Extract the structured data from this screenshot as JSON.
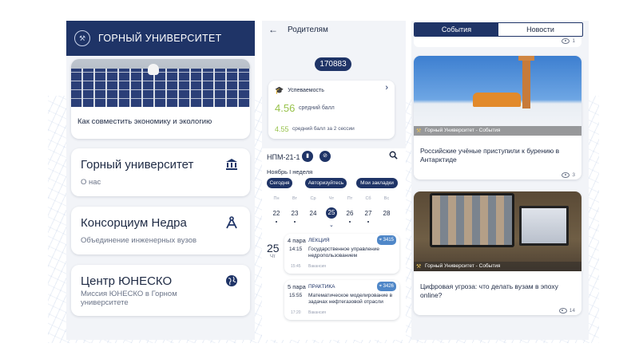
{
  "app1": {
    "header_title": "ГОРНЫЙ УНИВЕРСИТЕТ",
    "featured_caption": "Как совместить экономику и экологию",
    "menu": [
      {
        "title": "Горный университет",
        "subtitle": "О нас"
      },
      {
        "title": "Консорциум Недра",
        "subtitle": "Объединение инженерных вузов"
      },
      {
        "title": "Центр ЮНЕСКО",
        "subtitle": "Миссия ЮНЕСКО в Горном университете"
      }
    ]
  },
  "app2": {
    "header_title": "Родителям",
    "student_id": "170883",
    "performance": {
      "label": "Успеваемость",
      "avg": "4.56",
      "avg_label": "средний балл",
      "avg2": "4.55",
      "avg2_label": "средний балл за 2 сессии"
    },
    "schedule": {
      "group": "НПМ-21-1",
      "week": "Ноябрь I неделя",
      "chips": [
        "Сегодня",
        "Авторизуйтесь",
        "Мои закладки"
      ],
      "day_names": [
        "Пн",
        "Вт",
        "Ср",
        "Чт",
        "Пт",
        "Сб",
        "Вс"
      ],
      "day_numbers": [
        "22",
        "23",
        "24",
        "25",
        "26",
        "27",
        "28"
      ],
      "selected_day": "25",
      "selected_dow": "Чт",
      "lessons": [
        {
          "number": "4 пара",
          "type": "ЛЕКЦИЯ",
          "room": "3415",
          "start": "14:15",
          "end": "15:45",
          "name": "Государственное управление недропользованием",
          "note": "Вакансия"
        },
        {
          "number": "5 пара",
          "type": "ПРАКТИКА",
          "room": "3426",
          "start": "15:55",
          "end": "17:20",
          "name": "Математическое моделирование в задачах нефтегазовой отрасли",
          "note": "Вакансия"
        }
      ]
    }
  },
  "app3": {
    "tabs": [
      "События",
      "Новости"
    ],
    "active_tab": "События",
    "top_views": "1",
    "news": [
      {
        "caption": "Горный Университет - События",
        "title": "Российские учёные приступили к бурению в Антарктиде",
        "views": "3"
      },
      {
        "caption": "Горный Университет - События",
        "title": "Цифровая угроза: что делать вузам в эпоху online?",
        "views": "14"
      }
    ]
  },
  "colors": {
    "primary": "#1f3467",
    "accent_green": "#97c24a",
    "room_badge": "#4f87c8"
  },
  "icons": {
    "logo": "university-emblem-icon",
    "menu1": "institution-icon",
    "menu2": "compass-icon",
    "menu3": "globe-icon"
  }
}
